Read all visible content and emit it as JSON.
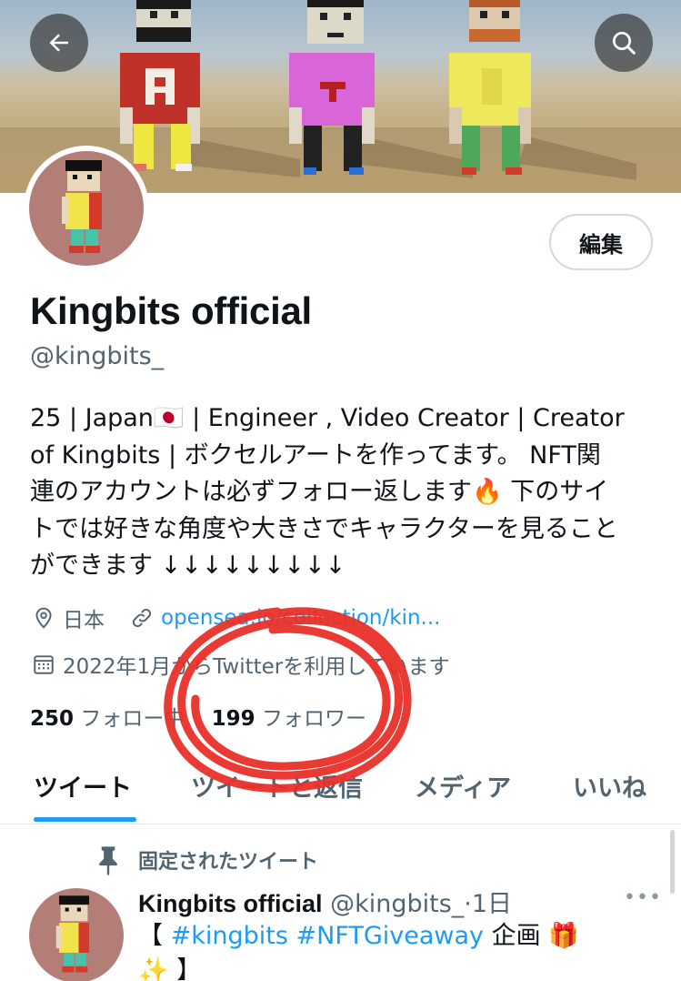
{
  "header": {
    "back_icon": "arrow-left-icon",
    "search_icon": "search-icon"
  },
  "profile": {
    "edit_label": "編集",
    "display_name": "Kingbits official",
    "handle": "@kingbits_",
    "bio_lines": [
      "25 | Japan🇯🇵 | Engineer , Video Creator | Creator",
      "of Kingbits | ボクセルアートを作ってます。 NFT関",
      "連のアカウントは必ずフォロー返します🔥 下のサイ",
      "トでは好きな角度や大きさでキャラクターを見ること",
      "ができます ↓↓↓↓↓↓↓↓↓"
    ],
    "location": "日本",
    "url": "opensea.io/collection/kin...",
    "joined": "2022年1月からTwitterを利用しています",
    "following_count": "250",
    "following_label": "フォロー中",
    "followers_count": "199",
    "followers_label": "フォロワー"
  },
  "tabs": [
    {
      "label": "ツイート",
      "active": true
    },
    {
      "label": "ツイートと返信",
      "active": false
    },
    {
      "label": "メディア",
      "active": false
    },
    {
      "label": "いいね",
      "active": false
    }
  ],
  "pinned_tweet": {
    "pinned_label": "固定されたツイート",
    "author_name": "Kingbits official",
    "author_handle": "@kingbits_",
    "separator": "·",
    "time": "1日",
    "more": "•••",
    "text_open": "【 ",
    "hashtag1": "#kingbits",
    "hashtag2": "#NFTGiveaway",
    "text_after": " 企画 🎁",
    "text_line2": "✨ 】"
  },
  "colors": {
    "accent": "#1d9bf0",
    "annotation": "#e8312a",
    "muted_text": "#536471"
  }
}
